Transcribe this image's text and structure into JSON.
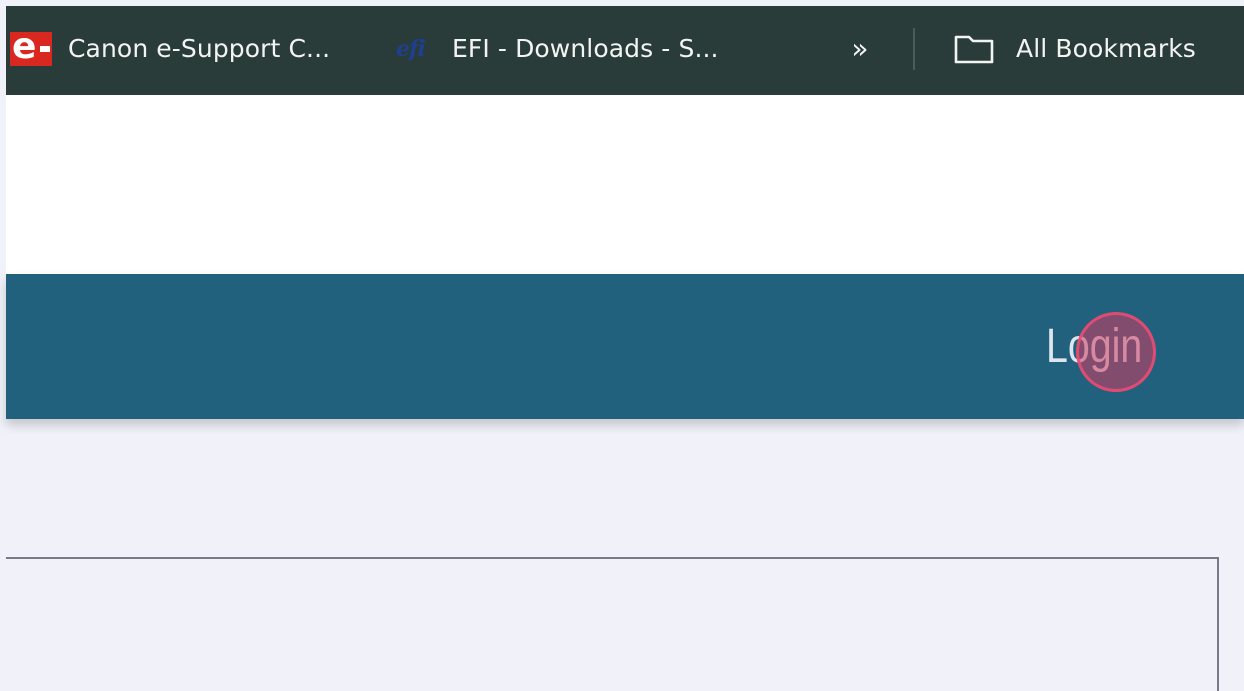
{
  "bookmarks_bar": {
    "items": [
      {
        "label": "Canon e-Support C...",
        "icon": "canon-e-favicon"
      },
      {
        "label": "EFI - Downloads - S...",
        "icon": "efi-favicon"
      }
    ],
    "overflow_label": "»",
    "all_bookmarks": {
      "label": "All Bookmarks",
      "icon": "folder-icon"
    },
    "favicon_text": {
      "canon": "e",
      "efi": "efi"
    }
  },
  "header": {
    "login_label": "Login"
  },
  "colors": {
    "bookmarks_bar_bg": "#2a3c39",
    "header_bg": "#22617d",
    "page_bg": "#f0f1f9",
    "click_marker": "#d23c64"
  }
}
